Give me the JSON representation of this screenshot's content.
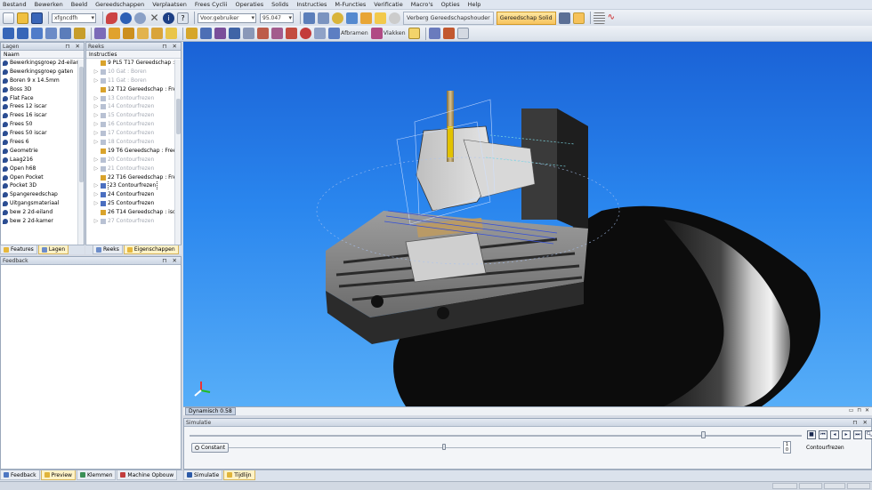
{
  "menubar": [
    "Bestand",
    "Bewerken",
    "Beeld",
    "Gereedschappen",
    "Verplaatsen",
    "Frees Cyclii",
    "Operaties",
    "Solids",
    "Instructies",
    "M-Functies",
    "Verificatie",
    "Macro's",
    "Opties",
    "Help"
  ],
  "toolbar1": {
    "combo1": "xfgncdfh",
    "combo2": "Voor.gebruiker",
    "combo3": "95.047",
    "hide_holder_label": "Verberg Gereedschapshouder",
    "tool_solid_label": "Gereedschap Solid"
  },
  "toolbar2": {
    "afbramen_label": "Afbramen",
    "vlakken_label": "Vlakken"
  },
  "layers_panel": {
    "title": "Lagen",
    "column": "Naam",
    "items": [
      "Bewerkingsgroep 2d-eilan",
      "Bewerkingsgroep gaten",
      "Boren 9 x 14.5mm",
      "Boss 3D",
      "Flat Face",
      "Frees 12 iscar",
      "Frees 16 iscar",
      "Frees 50",
      "Frees 50 iscar",
      "Frees 6",
      "Geometrie",
      "Laag216",
      "Open h68",
      "Open Pocket",
      "Pocket 3D",
      "Spangereedschap",
      "Uitgangsmateriaal",
      "bew 2 2d-eiland",
      "bew 2 2d-kamer"
    ],
    "tabs": [
      "Features",
      "Lagen"
    ]
  },
  "sequence_panel": {
    "title": "Reeks",
    "column": "Instructies",
    "items": [
      {
        "text": "9 PL5 T17 Gereedschap :",
        "grey": false,
        "expander": false
      },
      {
        "text": "10 Gat : Boren",
        "grey": true,
        "expander": true
      },
      {
        "text": "11 Gat : Boren",
        "grey": true,
        "expander": true
      },
      {
        "text": "12 T12 Gereedschap : Fre",
        "grey": false,
        "expander": false
      },
      {
        "text": "13 Contourfrezen",
        "grey": true,
        "expander": true
      },
      {
        "text": "14 Contourfrezen",
        "grey": true,
        "expander": true
      },
      {
        "text": "15 Contourfrezen",
        "grey": true,
        "expander": true
      },
      {
        "text": "16 Contourfrezen",
        "grey": true,
        "expander": true
      },
      {
        "text": "17 Contourfrezen",
        "grey": true,
        "expander": true
      },
      {
        "text": "18 Contourfrezen",
        "grey": true,
        "expander": true
      },
      {
        "text": "19 T6 Gereedschap : Free",
        "grey": false,
        "expander": false
      },
      {
        "text": "20 Contourfrezen",
        "grey": true,
        "expander": true
      },
      {
        "text": "21 Contourfrezen",
        "grey": true,
        "expander": true
      },
      {
        "text": "22 T16 Gereedschap : Fre",
        "grey": false,
        "expander": false
      },
      {
        "text": "23 Contourfrezen",
        "grey": false,
        "expander": true,
        "selected": true
      },
      {
        "text": "24 Contourfrezen",
        "grey": false,
        "expander": true
      },
      {
        "text": "25 Contourfrezen",
        "grey": false,
        "expander": true
      },
      {
        "text": "26 T14 Gereedschap : isca",
        "grey": false,
        "expander": false
      },
      {
        "text": "27 Contourfrezen",
        "grey": true,
        "expander": true
      }
    ],
    "tabs": [
      "Reeks",
      "Eigenschappen"
    ]
  },
  "feedback_panel": {
    "title": "Feedback"
  },
  "viewport": {
    "mode_label": "Dynamisch 0.58"
  },
  "simulation": {
    "title": "Simulatie",
    "constant_label": "Constant",
    "spinner_top": "1",
    "spinner_bottom": "0",
    "operation_label": "Contourfrezen",
    "main_progress": 0.84,
    "speed_position": 0.39
  },
  "bottom_tabs_left": [
    "Feedback",
    "Preview",
    "Klemmen",
    "Machine Opbouw"
  ],
  "bottom_tabs_right": [
    "Simulatie",
    "Tijdlijn"
  ],
  "colors": {
    "viewport_top": "#1a62d6",
    "viewport_bottom": "#57aef8",
    "active_tab": "#fff3c7",
    "tool_solid_active": "#f7c35d"
  }
}
